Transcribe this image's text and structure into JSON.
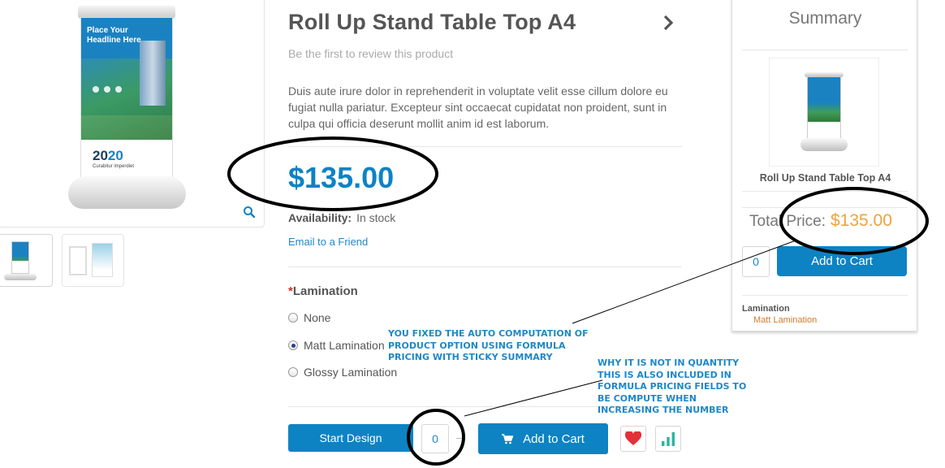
{
  "product": {
    "title": "Roll Up Stand Table Top A4",
    "review_link": "Be the first to review this product",
    "description": "Duis aute irure dolor in reprehenderit in voluptate velit esse cillum dolore eu fugiat nulla pariatur. Excepteur sint occaecat cupidatat non proident, sunt in culpa qui officia deserunt mollit anim id est laborum.",
    "price": "$135.00",
    "availability_label": "Availability:",
    "availability_value": "In stock",
    "email_friend": "Email to a Friend",
    "banner_headline": "Place Your Headline Here",
    "banner_year_a": "20",
    "banner_year_b": "20",
    "banner_sub": "Curabitur imperdiet"
  },
  "lamination": {
    "required_mark": "*",
    "title": "Lamination",
    "options": [
      {
        "label": "None",
        "checked": false
      },
      {
        "label": "Matt Lamination",
        "checked": true
      },
      {
        "label": "Glossy Lamination",
        "checked": false
      }
    ]
  },
  "actions": {
    "start_design": "Start Design",
    "quantity": "0",
    "add_to_cart": "Add to Cart"
  },
  "summary": {
    "title": "Summary",
    "product_name": "Roll Up Stand Table Top A4",
    "total_label": "Total Price:",
    "total_value": "$135.00",
    "quantity": "0",
    "add_to_cart": "Add to Cart",
    "option_label": "Lamination",
    "option_value": "Matt Lamination"
  },
  "annotations": {
    "note1": "YOU FIXED THE AUTO COMPUTATION OF PRODUCT OPTION USING FORMULA PRICING WITH STICKY SUMMARY",
    "note2": "WHY IT IS NOT IN QUANTITY THIS IS ALSO INCLUDED IN FORMULA PRICING FIELDS TO BE COMPUTE WHEN INCREASING THE NUMBER"
  },
  "colors": {
    "accent": "#0d83c4",
    "summary_price": "#f0a23a",
    "option_value": "#d17a2b",
    "annotation": "#1e88c8"
  },
  "icons": [
    "zoom-icon",
    "chevron-right-icon",
    "cart-icon",
    "heart-icon",
    "bar-chart-icon"
  ]
}
